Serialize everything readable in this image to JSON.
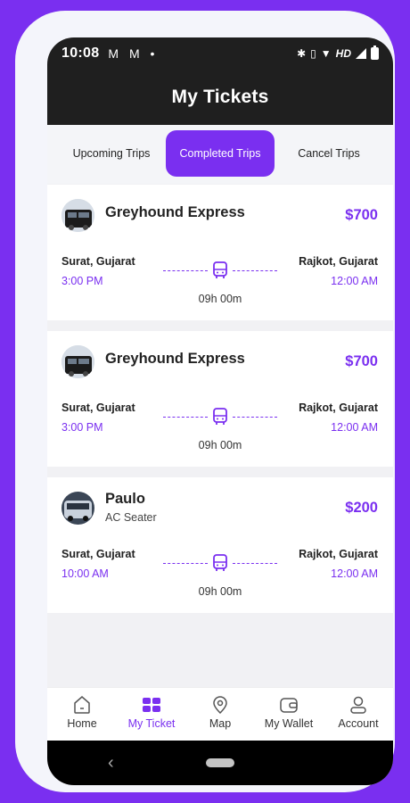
{
  "status_bar": {
    "time": "10:08",
    "notifications": "M M •",
    "network": "HD"
  },
  "header": {
    "title": "My Tickets"
  },
  "tabs": [
    {
      "label": "Upcoming Trips",
      "active": false
    },
    {
      "label": "Completed Trips",
      "active": true
    },
    {
      "label": "Cancel Trips",
      "active": false
    }
  ],
  "tickets": [
    {
      "operator": "Greyhound Express",
      "seat_type": "",
      "price": "$700",
      "from": "Surat, Gujarat",
      "departure": "3:00 PM",
      "to": "Rajkot, Gujarat",
      "arrival": "12:00 AM",
      "duration": "09h 00m"
    },
    {
      "operator": "Greyhound Express",
      "seat_type": "",
      "price": "$700",
      "from": "Surat, Gujarat",
      "departure": "3:00 PM",
      "to": "Rajkot, Gujarat",
      "arrival": "12:00 AM",
      "duration": "09h 00m"
    },
    {
      "operator": "Paulo",
      "seat_type": "AC Seater",
      "price": "$200",
      "from": "Surat, Gujarat",
      "departure": "10:00 AM",
      "to": "Rajkot, Gujarat",
      "arrival": "12:00 AM",
      "duration": "09h 00m"
    }
  ],
  "bottom_nav": [
    {
      "label": "Home",
      "icon": "home-icon",
      "active": false
    },
    {
      "label": "My Ticket",
      "icon": "ticket-icon",
      "active": true
    },
    {
      "label": "Map",
      "icon": "map-pin-icon",
      "active": false
    },
    {
      "label": "My Wallet",
      "icon": "wallet-icon",
      "active": false
    },
    {
      "label": "Account",
      "icon": "user-icon",
      "active": false
    }
  ],
  "colors": {
    "accent": "#7a2ff0",
    "header_bg": "#1f1f1f",
    "list_bg": "#f1f1f4"
  }
}
